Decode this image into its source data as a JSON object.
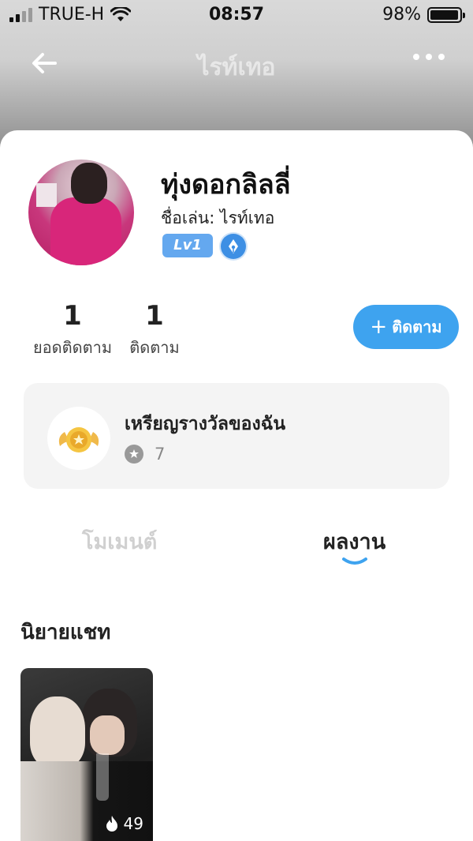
{
  "status_bar": {
    "carrier": "TRUE-H",
    "time": "08:57",
    "battery": "98%",
    "battery_level": 0.98,
    "signal_bars_active": 2,
    "signal_bars_total": 4
  },
  "nav": {
    "title": "ไรท์เทอ",
    "back_icon": "back-arrow-icon",
    "more_icon": "more-dots-icon"
  },
  "profile": {
    "name": "ทุ่งดอกลิลลี่",
    "nickname": "ชื่อเล่น: ไรท์เทอ",
    "level": "Lv1",
    "writer_icon": "pen-nib-icon"
  },
  "stats": {
    "followers_count": "1",
    "followers_label": "ยอดติดตาม",
    "following_count": "1",
    "following_label": "ติดตาม"
  },
  "follow_button": {
    "label": "ติดตาม",
    "icon": "plus-icon"
  },
  "medals": {
    "title": "เหรียญรางวัลของฉัน",
    "count": "7",
    "icon": "medal-icon"
  },
  "tabs": {
    "moment": "โมเมนต์",
    "works": "ผลงาน",
    "active": "works"
  },
  "section": {
    "title": "นิยายแชท"
  },
  "story": {
    "views": "49",
    "icon": "flame-icon"
  },
  "colors": {
    "accent": "#3ea3ef",
    "level_badge": "#64a8ef",
    "card_bg": "#f4f4f4"
  }
}
